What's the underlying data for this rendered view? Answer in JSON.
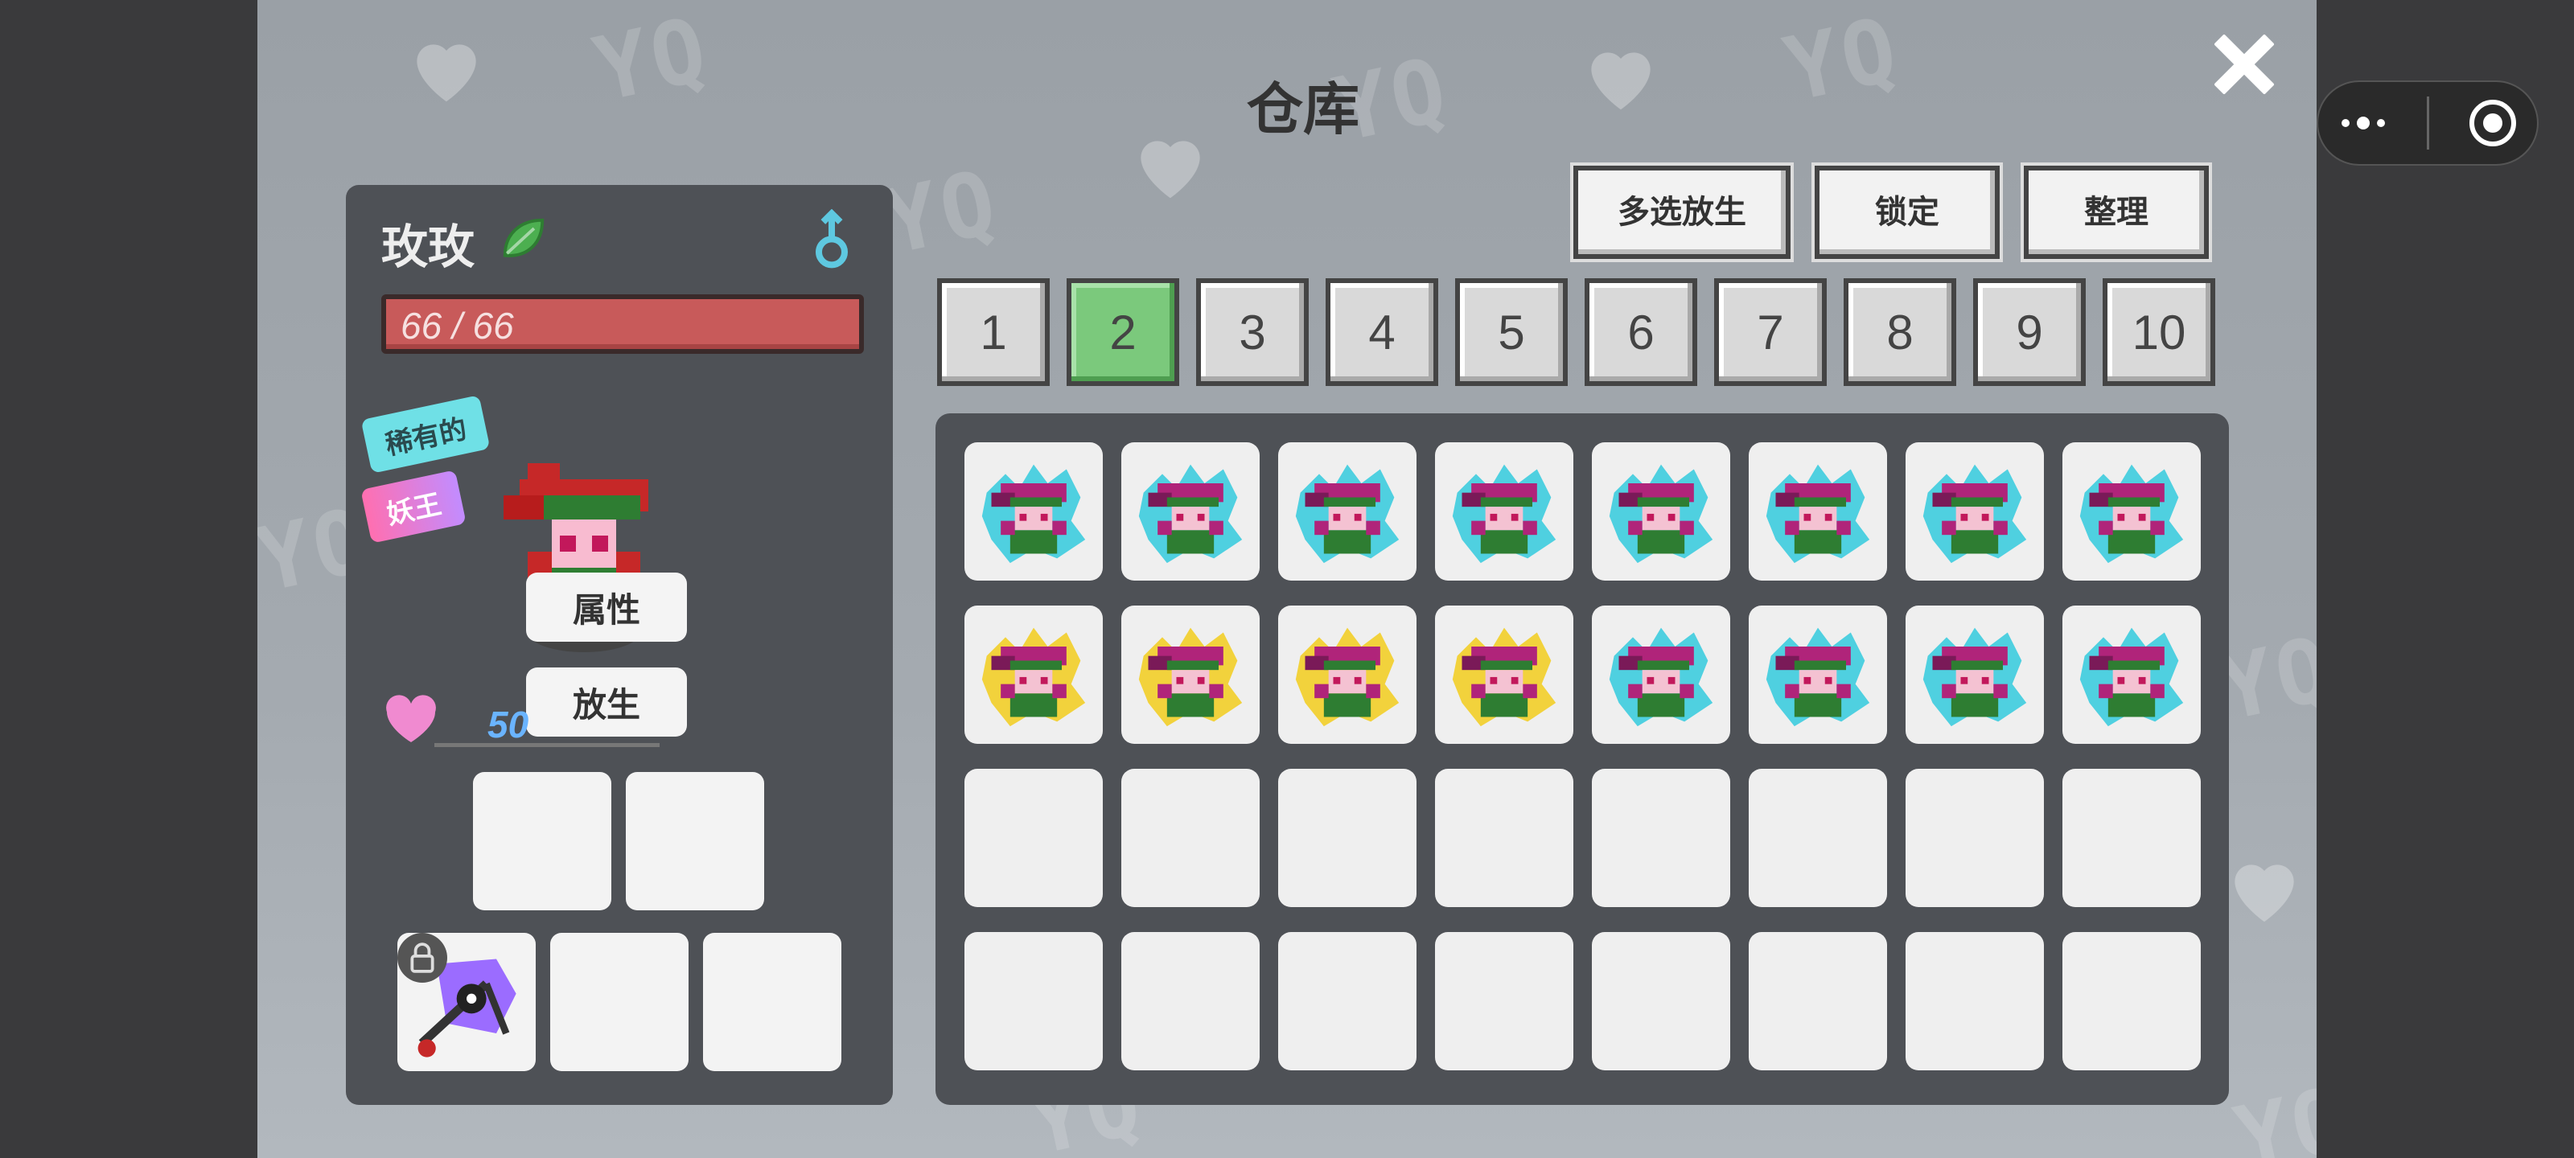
{
  "title": "仓库",
  "toolbar": {
    "multi_release": "多选放生",
    "lock": "锁定",
    "sort": "整理"
  },
  "tabs": [
    {
      "label": "1",
      "active": false
    },
    {
      "label": "2",
      "active": true
    },
    {
      "label": "3",
      "active": false
    },
    {
      "label": "4",
      "active": false
    },
    {
      "label": "5",
      "active": false
    },
    {
      "label": "6",
      "active": false
    },
    {
      "label": "7",
      "active": false
    },
    {
      "label": "8",
      "active": false
    },
    {
      "label": "9",
      "active": false
    },
    {
      "label": "10",
      "active": false
    }
  ],
  "pet": {
    "name": "玫玫",
    "hp": "66 / 66",
    "rarity_tag": "稀有的",
    "rank_tag": "妖王",
    "affection": "50",
    "buttons": {
      "attributes": "属性",
      "release": "放生"
    },
    "element_icon": "leaf-icon",
    "gender_icon": "male-icon"
  },
  "equipment": {
    "row1": [
      "empty",
      "empty"
    ],
    "row2": [
      "weapon",
      "empty",
      "empty"
    ]
  },
  "storage": {
    "rows": [
      [
        "cyan",
        "cyan",
        "cyan",
        "cyan",
        "cyan",
        "cyan",
        "cyan",
        "cyan"
      ],
      [
        "gold",
        "gold",
        "gold",
        "gold",
        "cyan",
        "cyan",
        "cyan",
        "cyan"
      ],
      [
        "empty",
        "empty",
        "empty",
        "empty",
        "empty",
        "empty",
        "empty",
        "empty"
      ],
      [
        "empty",
        "empty",
        "empty",
        "empty",
        "empty",
        "empty",
        "empty",
        "empty"
      ]
    ]
  },
  "colors": {
    "active_tab": "#7bc97c",
    "panel": "#4e5156",
    "hp_bar": "#c85a5a",
    "accent_cyan": "#4fd0e0",
    "accent_gold": "#f2d23c"
  }
}
